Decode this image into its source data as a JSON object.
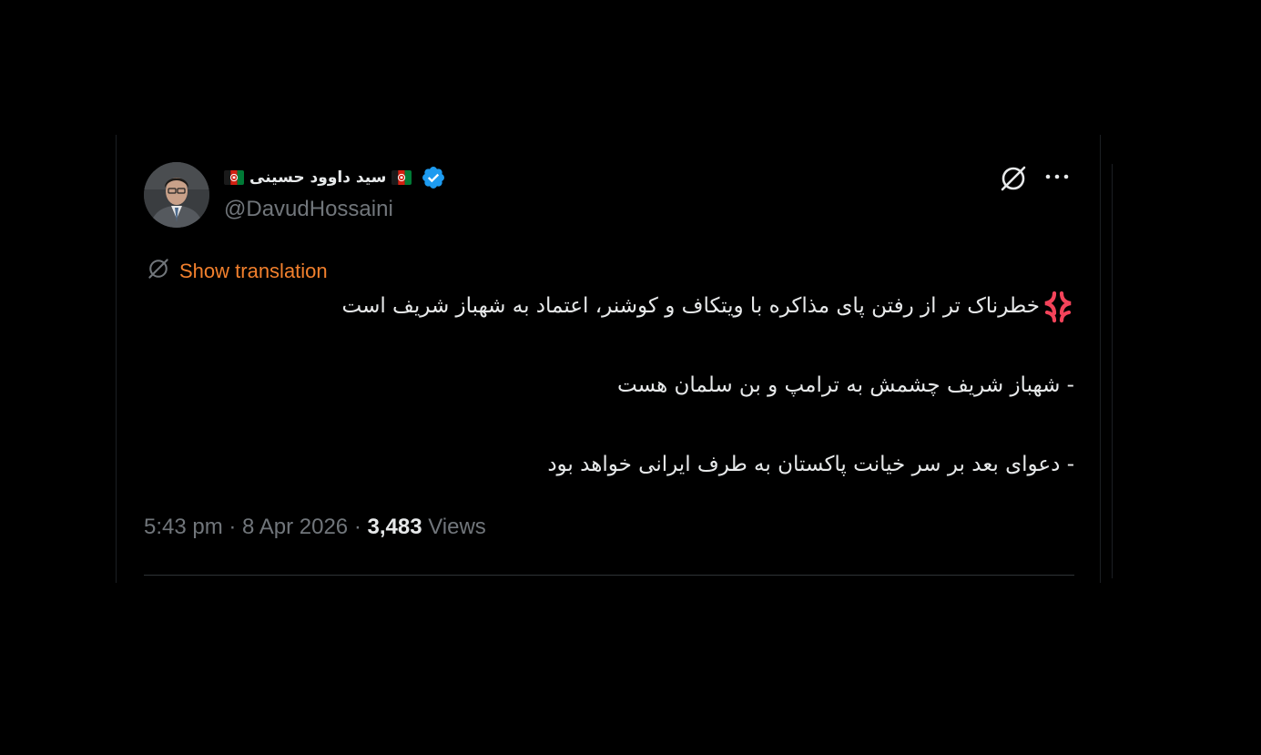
{
  "tweet": {
    "author": {
      "display_name": "سید داوود حسینی",
      "handle": "@DavudHossaini",
      "verified": true,
      "flag_icon": "afghanistan-flag-icon"
    },
    "actions": {
      "grok_icon": "grok-icon",
      "more_icon": "more-icon"
    },
    "translate_label": "Show translation",
    "body": {
      "emoji": "anger-symbol-icon",
      "line1": "خطرناک تر از رفتن پای مذاکره با ویتکاف و کوشنر، اعتماد به شهباز شریف است",
      "line2": "- شهباز شریف چشمش به ترامپ و بن سلمان هست",
      "line3": "- دعوای بعد بر سر خیانت پاکستان به طرف ایرانی خواهد بود"
    },
    "meta": {
      "time": "5:43 pm",
      "separator": " · ",
      "date": "8 Apr 2026",
      "views_count": "3,483",
      "views_label": "Views"
    }
  },
  "colors": {
    "background": "#000000",
    "text_primary": "#e7e9ea",
    "text_secondary": "#71767b",
    "accent_translate": "#f2802d",
    "verified_blue": "#1d9bf0",
    "anger_red": "#f4435a"
  }
}
